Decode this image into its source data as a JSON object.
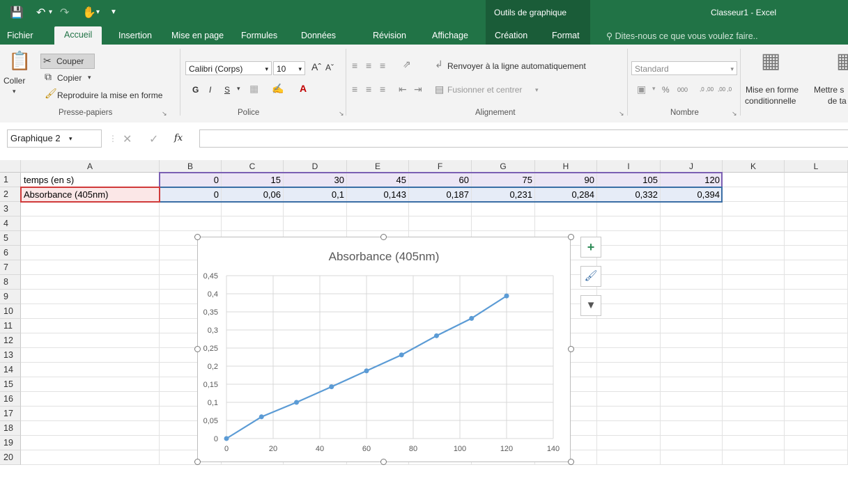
{
  "window": {
    "title": "Classeur1 - Excel",
    "context_header": "Outils de graphique",
    "quick_access": {
      "save_icon": "save-icon",
      "undo_icon": "undo-icon",
      "redo_icon": "redo-icon",
      "touch_icon": "touch-mode-icon",
      "customize_icon": "customize-qat-icon"
    }
  },
  "tabs": [
    {
      "label": "Fichier"
    },
    {
      "label": "Accueil"
    },
    {
      "label": "Insertion"
    },
    {
      "label": "Mise en page"
    },
    {
      "label": "Formules"
    },
    {
      "label": "Données"
    },
    {
      "label": "Révision"
    },
    {
      "label": "Affichage"
    },
    {
      "label": "Création"
    },
    {
      "label": "Format"
    }
  ],
  "tell_me": "Dites-nous ce que vous voulez faire..",
  "ribbon": {
    "clipboard": {
      "paste": "Coller",
      "cut": "Couper",
      "copy": "Copier",
      "format_painter": "Reproduire la mise en forme",
      "group": "Presse-papiers"
    },
    "font": {
      "name": "Calibri (Corps)",
      "size": "10",
      "bold": "G",
      "italic": "I",
      "underline": "S",
      "group": "Police"
    },
    "alignment": {
      "wrap": "Renvoyer à la ligne automatiquement",
      "merge": "Fusionner et centrer",
      "group": "Alignement"
    },
    "number": {
      "format": "Standard",
      "percent": "%",
      "thousands": "000",
      "inc_dec": ",0 ,00",
      "dec_dec": ",00 ,0",
      "group": "Nombre"
    },
    "styles": {
      "conditional": "Mise en forme",
      "conditional2": "conditionnelle",
      "table": "Mettre s",
      "table2": "de ta"
    }
  },
  "formula_bar": {
    "name_box": "Graphique 2",
    "fx": "fx",
    "value": ""
  },
  "sheet": {
    "columns": [
      "A",
      "B",
      "C",
      "D",
      "E",
      "F",
      "G",
      "H",
      "I",
      "J",
      "K",
      "L"
    ],
    "rows": [
      "1",
      "2",
      "3",
      "4",
      "5",
      "6",
      "7",
      "8",
      "9",
      "10",
      "11",
      "12",
      "13",
      "14",
      "15",
      "16",
      "17",
      "18",
      "19",
      "20"
    ],
    "data": [
      [
        "temps (en s)",
        "0",
        "15",
        "30",
        "45",
        "60",
        "75",
        "90",
        "105",
        "120"
      ],
      [
        "Absorbance (405nm)",
        "0",
        "0,06",
        "0,1",
        "0,143",
        "0,187",
        "0,231",
        "0,284",
        "0,332",
        "0,394"
      ]
    ]
  },
  "chart_data": {
    "type": "line",
    "title": "Absorbance (405nm)",
    "x": [
      0,
      15,
      30,
      45,
      60,
      75,
      90,
      105,
      120
    ],
    "series": [
      {
        "values": [
          0,
          0.06,
          0.1,
          0.143,
          0.187,
          0.231,
          0.284,
          0.332,
          0.394
        ]
      }
    ],
    "xlim": [
      0,
      140
    ],
    "ylim": [
      0,
      0.45
    ],
    "xticks": [
      "0",
      "20",
      "40",
      "60",
      "80",
      "100",
      "120",
      "140"
    ],
    "yticks": [
      "0",
      "0,05",
      "0,1",
      "0,15",
      "0,2",
      "0,25",
      "0,3",
      "0,35",
      "0,4",
      "0,45"
    ],
    "grid": true,
    "line_color": "#5b9bd5"
  },
  "chart_buttons": {
    "add": "chart-elements-icon",
    "style": "chart-styles-icon",
    "filter": "chart-filters-icon"
  }
}
